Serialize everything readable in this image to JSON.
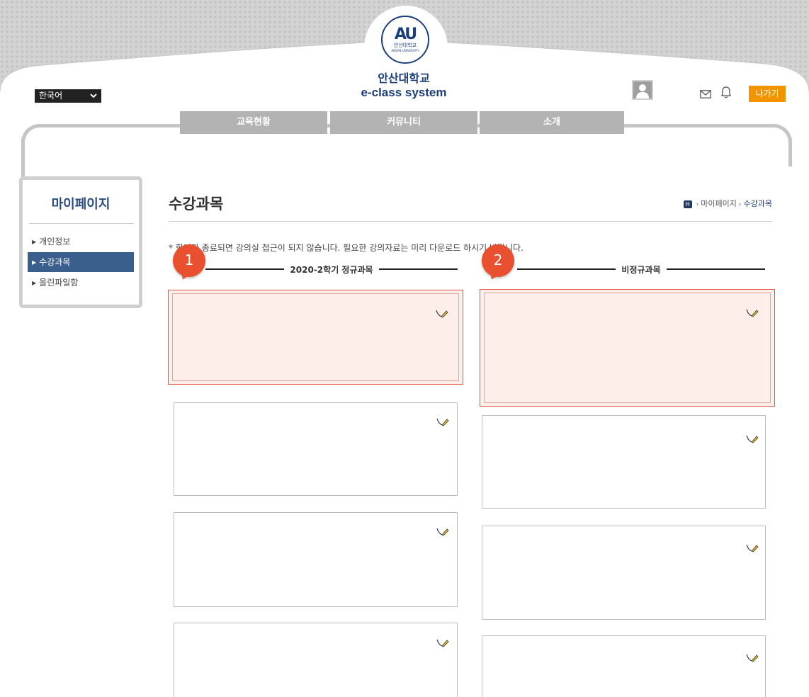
{
  "header": {
    "logo_mark": "AU",
    "logo_sub": "안산대학교",
    "logo_tiny": "ANSAN UNIVERSITY",
    "school_name": "안산대학교",
    "system_name": "e-class system",
    "language": "한국어",
    "exit_label": "나가기"
  },
  "nav": {
    "tabs": [
      "교육현황",
      "커뮤니티",
      "소개"
    ]
  },
  "sidebar": {
    "title": "마이페이지",
    "items": [
      {
        "label": "개인정보"
      },
      {
        "label": "수강과목"
      },
      {
        "label": "올린파일함"
      }
    ],
    "active_index": 1
  },
  "main": {
    "title": "수강과목",
    "breadcrumb": {
      "home": "H",
      "parent": "마이페이지",
      "current": "수강과목"
    },
    "notice": "* 학기가 종료되면 강의실 접근이 되지 않습니다. 필요한 강의자료는 미리 다운로드 하시기 바랍니다.",
    "regular_heading": "2020-2학기 정규과목",
    "irregular_heading": "비정규과목",
    "badges": [
      "1",
      "2"
    ]
  },
  "colors": {
    "brand": "#1c3e7c",
    "exit": "#f29400",
    "sidebar_active": "#3b5f8d",
    "badge": "#e8502f",
    "highlight_bg": "#fdeeea"
  }
}
